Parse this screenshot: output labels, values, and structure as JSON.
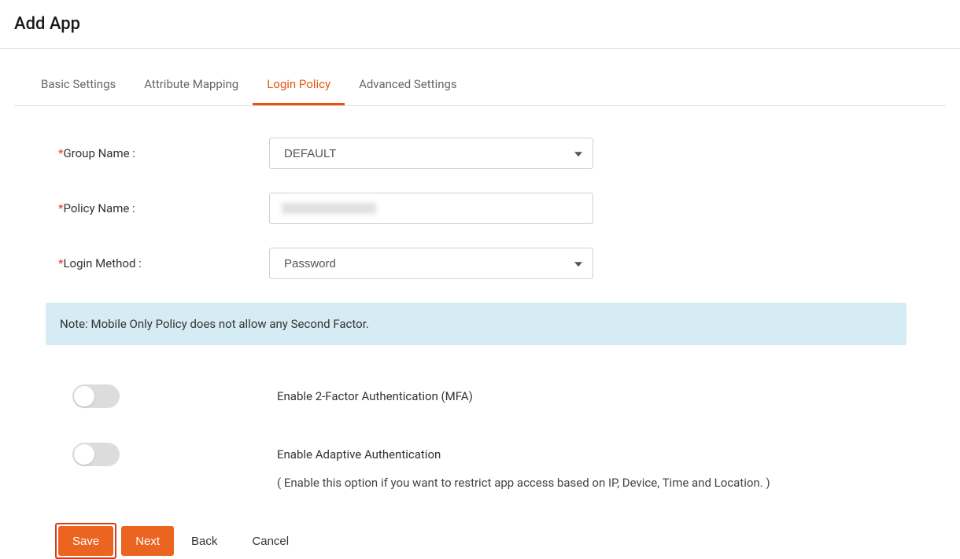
{
  "header": {
    "title": "Add App"
  },
  "tabs": {
    "items": [
      {
        "label": "Basic Settings",
        "active": false
      },
      {
        "label": "Attribute Mapping",
        "active": false
      },
      {
        "label": "Login Policy",
        "active": true
      },
      {
        "label": "Advanced Settings",
        "active": false
      }
    ]
  },
  "form": {
    "group_name": {
      "label": "Group Name :",
      "value": "DEFAULT"
    },
    "policy_name": {
      "label": "Policy Name :",
      "value": ""
    },
    "login_method": {
      "label": "Login Method :",
      "value": "Password"
    }
  },
  "note": {
    "text": "Note: Mobile Only Policy does not allow any Second Factor."
  },
  "toggles": {
    "mfa": {
      "label": "Enable 2-Factor Authentication (MFA)",
      "on": false
    },
    "adaptive": {
      "label": "Enable Adaptive Authentication",
      "sub": "( Enable this option if you want to restrict app access based on IP, Device, Time and Location. )",
      "on": false
    }
  },
  "buttons": {
    "save": "Save",
    "next": "Next",
    "back": "Back",
    "cancel": "Cancel"
  }
}
